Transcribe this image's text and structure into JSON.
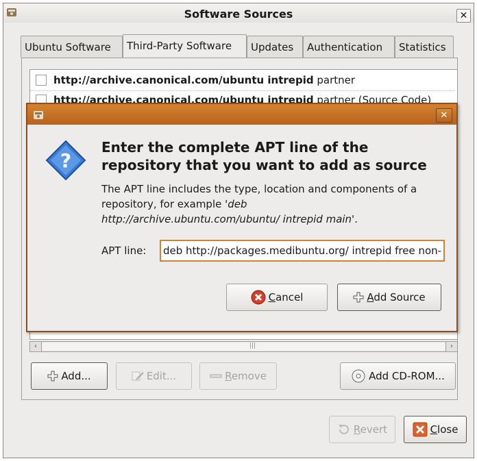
{
  "window": {
    "title": "Software Sources"
  },
  "tabs": [
    {
      "label": "Ubuntu Software"
    },
    {
      "label": "Third-Party Software"
    },
    {
      "label": "Updates"
    },
    {
      "label": "Authentication"
    },
    {
      "label": "Statistics"
    }
  ],
  "sources": [
    {
      "url": "http://archive.canonical.com/ubuntu intrepid",
      "suffix": "partner"
    },
    {
      "url": "http://archive.canonical.com/ubuntu intrepid",
      "suffix": "partner (Source Code)"
    }
  ],
  "buttons": {
    "add": "Add...",
    "edit": "Edit...",
    "remove_prefix": "",
    "remove_accel": "R",
    "remove_rest": "emove",
    "add_cdrom": "Add CD-ROM...",
    "revert_accel": "R",
    "revert_rest": "evert",
    "close_accel": "C",
    "close_rest": "lose"
  },
  "dialog": {
    "heading": "Enter the complete APT line of the repository that you want to add as source",
    "description_plain": "The APT line includes the type, location and components of a repository, for example ",
    "description_example": "'deb http://archive.ubuntu.com/ubuntu/ intrepid main'",
    "description_end": ".",
    "apt_label": "APT line:",
    "apt_value": "deb http://packages.medibuntu.org/ intrepid free non-free",
    "cancel_accel": "C",
    "cancel_rest": "ancel",
    "add_source_accel": "A",
    "add_source_rest": "dd Source"
  },
  "colors": {
    "dialog_titlebar": "#c46f26",
    "input_focus": "#d1812f",
    "question_icon": "#3a7bd5",
    "cancel_icon": "#d43d2a",
    "close_icon": "#e0602b"
  }
}
